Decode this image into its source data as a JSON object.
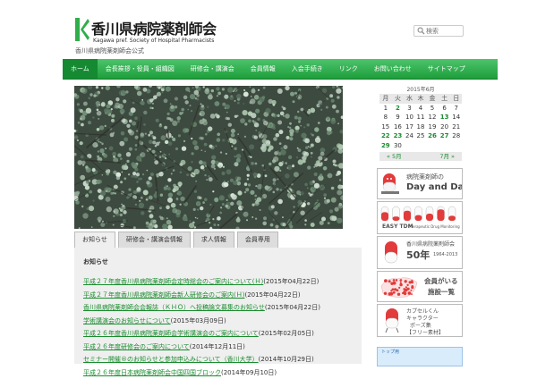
{
  "header": {
    "logo_mark": "K",
    "title": "香川県病院薬剤師会",
    "subtitle": "Kagawa pref. Society of Hospital Pharmacists",
    "tagline": "香川県病院薬剤師会公式"
  },
  "search": {
    "placeholder": "検索"
  },
  "nav": {
    "items": [
      "ホーム",
      "会長挨拶・役員・組織図",
      "研修会・講演会",
      "会員情報",
      "入会手続き",
      "リンク",
      "お問い合わせ",
      "サイトマップ"
    ]
  },
  "tabs": [
    "お知らせ",
    "研修会・講演会情報",
    "求人情報",
    "会員専用"
  ],
  "main": {
    "section_title": "お知らせ",
    "news": [
      {
        "text": "平成２７年度香川県病院薬剤師会定時総会のご案内について(Ｈ)",
        "date": "(2015年04月22日)"
      },
      {
        "text": "平成２７年度香川県病院薬剤師会新人研修会のご案内(Ｈ)",
        "date": "(2015年04月22日)"
      },
      {
        "text": "香川県病院薬剤師会会報誌（ＫＨＯ）へ投稿論文募集のお知らせ",
        "date": "(2015年04月22日)"
      },
      {
        "text": "学術講演会のお知らせについて",
        "date": "(2015年03月09日)"
      },
      {
        "text": "平成２６年度香川県病院薬剤師会学術講演会のご案内について",
        "date": "(2015年02月05日)"
      },
      {
        "text": "平成２６年度研修会のご案内について",
        "date": "(2014年12月11日)"
      },
      {
        "text": "セミナー開催®のお知らせと参加申込みについて（香川大学）",
        "date": "(2014年10月29日)"
      },
      {
        "text": "平成２６年度日本病院薬剤師会中国四国ブロック",
        "date": "(2014年09月10日)"
      }
    ]
  },
  "calendar": {
    "caption": "2015年6月",
    "headers": [
      "月",
      "火",
      "水",
      "木",
      "金",
      "土",
      "日"
    ],
    "rows": [
      [
        "1",
        "2",
        "3",
        "4",
        "5",
        "6",
        "7"
      ],
      [
        "8",
        "9",
        "10",
        "11",
        "12",
        "13",
        "14"
      ],
      [
        "15",
        "16",
        "17",
        "18",
        "19",
        "20",
        "21"
      ],
      [
        "22",
        "23",
        "24",
        "25",
        "26",
        "27",
        "28"
      ],
      [
        "29",
        "30",
        "",
        "",
        "",
        "",
        ""
      ]
    ],
    "linked_days": [
      "2",
      "13",
      "22",
      "23",
      "26",
      "27",
      "29"
    ],
    "prev": "« 5月",
    "next": "7月 »"
  },
  "banners": [
    {
      "title": "病院薬剤師の",
      "subtitle": "Day and Day"
    },
    {
      "title": "EASY TDM",
      "subtitle": "Therapeutic Drug Monitoring"
    },
    {
      "title": "香川県病院薬剤師会",
      "subtitle": "50年",
      "years": "1964-2013"
    },
    {
      "title": "会員がいる",
      "subtitle": "施設一覧"
    },
    {
      "title": "カプセルくん",
      "subtitle": "キャラクター",
      "extra": "ポーズ集",
      "note": "【フリー素材】"
    },
    {
      "title": "トップ用"
    }
  ],
  "colors": {
    "accent": "#1f9e3b",
    "link": "#1a8c2e",
    "nav_active": "#158a32"
  }
}
